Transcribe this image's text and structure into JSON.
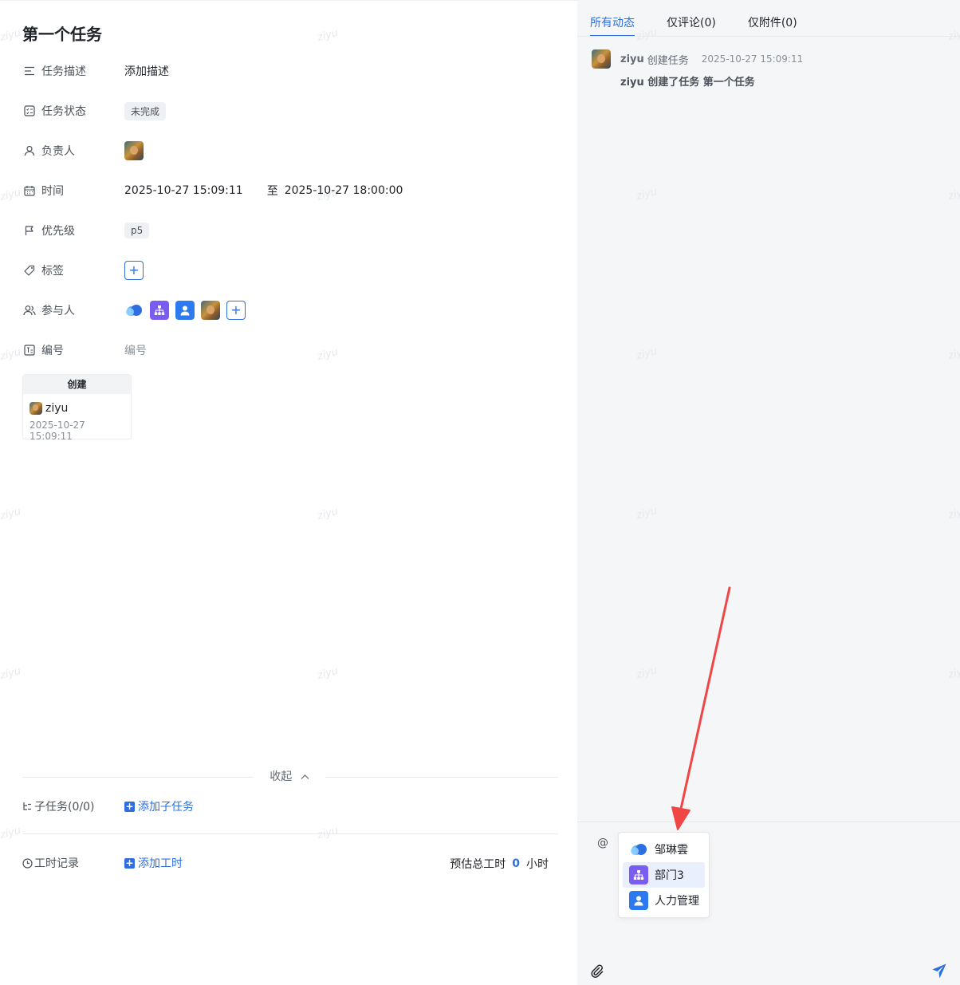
{
  "watermark_text": "ziyu",
  "task": {
    "title": "第一个任务",
    "fields": {
      "description": {
        "label": "任务描述",
        "value": "添加描述"
      },
      "status": {
        "label": "任务状态",
        "value": "未完成"
      },
      "owner": {
        "label": "负责人"
      },
      "time": {
        "label": "时间",
        "start": "2025-10-27 15:09:11",
        "separator": "至",
        "end": "2025-10-27 18:00:00"
      },
      "priority": {
        "label": "优先级",
        "value": "p5"
      },
      "tags": {
        "label": "标签",
        "add": "+"
      },
      "participants": {
        "label": "参与人",
        "add": "+"
      },
      "number": {
        "label": "编号",
        "placeholder": "编号"
      }
    },
    "creator_card": {
      "heading": "创建",
      "user": "ziyu",
      "time": "2025-10-27 15:09:11"
    },
    "collapse_label": "收起",
    "subtasks": {
      "label": "子任务(0/0)",
      "add_label": "添加子任务"
    },
    "worklog": {
      "label": "工时记录",
      "add_label": "添加工时",
      "estimate_label": "预估总工时",
      "estimate_value": "0",
      "estimate_unit": "小时"
    }
  },
  "activity_panel": {
    "tabs": [
      "所有动态",
      "仅评论(0)",
      "仅附件(0)"
    ],
    "active_tab": 0,
    "items": [
      {
        "user": "ziyu",
        "action": "创建任务",
        "time": "2025-10-27 15:09:11",
        "detail": "ziyu 创建了任务 第一个任务"
      }
    ]
  },
  "comment_box": {
    "mention_trigger": "@",
    "mention_options": [
      "邹琳雲",
      "部门3",
      "人力管理"
    ],
    "selected_option": 1
  },
  "colors": {
    "accent": "#2d6fe0",
    "arrow": "#f04646",
    "dept_icon": "#7a5cf0",
    "person_icon": "#2d7af0"
  }
}
